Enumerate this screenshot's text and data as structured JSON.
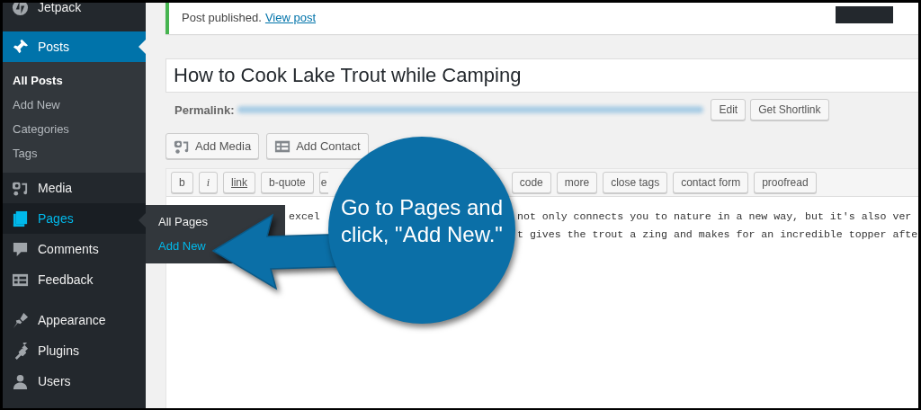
{
  "sidebar": {
    "items": [
      {
        "label": "Jetpack",
        "selected": false,
        "hovered": false
      },
      {
        "label": "Posts",
        "selected": true,
        "hovered": false,
        "children": [
          {
            "label": "All Posts",
            "selected": true
          },
          {
            "label": "Add New",
            "selected": false
          },
          {
            "label": "Categories",
            "selected": false
          },
          {
            "label": "Tags",
            "selected": false
          }
        ]
      },
      {
        "label": "Media",
        "selected": false,
        "hovered": false
      },
      {
        "label": "Pages",
        "selected": false,
        "hovered": true,
        "flyout": [
          {
            "label": "All Pages",
            "selected": false
          },
          {
            "label": "Add New",
            "selected": true
          }
        ]
      },
      {
        "label": "Comments",
        "selected": false,
        "hovered": false
      },
      {
        "label": "Feedback",
        "selected": false,
        "hovered": false
      },
      {
        "label": "Appearance",
        "selected": false,
        "hovered": false,
        "group_start": true
      },
      {
        "label": "Plugins",
        "selected": false,
        "hovered": false
      },
      {
        "label": "Users",
        "selected": false,
        "hovered": false
      }
    ]
  },
  "notice": {
    "text": "Post published.",
    "link": "View post"
  },
  "title_field": {
    "value": "How to Cook Lake Trout while Camping"
  },
  "permalink": {
    "label": "Permalink:",
    "buttons": [
      "Edit",
      "Get Shortlink"
    ]
  },
  "media_buttons": [
    "Add Media",
    "Add Contact"
  ],
  "quicktags": {
    "left": [
      "b",
      "i",
      "link",
      "b-quote",
      "e"
    ],
    "right": [
      "code",
      "more",
      "close tags",
      "contact form",
      "proofread"
    ]
  },
  "editor_lines": [
    {
      "left": "excel",
      "right": "not only connects you to nature in a new way, but it's also ver"
    },
    {
      "right": "t gives the trout a zing and makes for an incredible topper afte"
    }
  ],
  "callout": {
    "text": "Go to Pages and click, \"Add New.\""
  }
}
